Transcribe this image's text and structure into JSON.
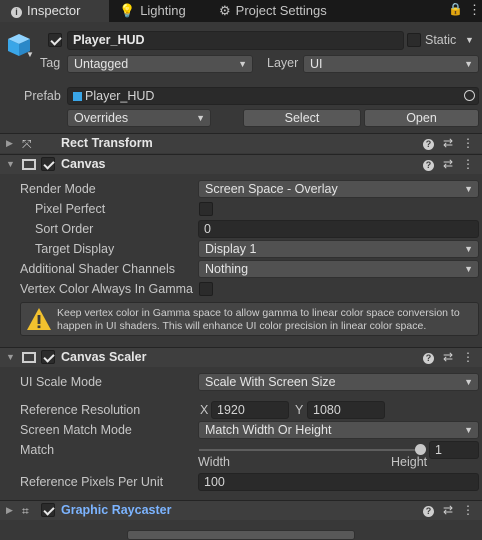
{
  "tabs": [
    {
      "label": "Inspector",
      "icon": "info-icon"
    },
    {
      "label": "Lighting",
      "icon": "bulb-icon"
    },
    {
      "label": "Project Settings",
      "icon": "gear-icon"
    }
  ],
  "object": {
    "name": "Player_HUD",
    "static_label": "Static",
    "tag_label": "Tag",
    "tag_value": "Untagged",
    "layer_label": "Layer",
    "layer_value": "UI",
    "prefab_label": "Prefab",
    "prefab_value": "Player_HUD",
    "overrides_label": "Overrides",
    "select_label": "Select",
    "open_label": "Open"
  },
  "components": {
    "rect_transform": {
      "title": "Rect Transform"
    },
    "canvas": {
      "title": "Canvas",
      "render_mode_label": "Render Mode",
      "render_mode_value": "Screen Space - Overlay",
      "pixel_perfect_label": "Pixel Perfect",
      "sort_order_label": "Sort Order",
      "sort_order_value": "0",
      "target_display_label": "Target Display",
      "target_display_value": "Display 1",
      "shader_channels_label": "Additional Shader Channels",
      "shader_channels_value": "Nothing",
      "vertex_color_label": "Vertex Color Always In Gamma",
      "warning_text": "Keep vertex color in Gamma space to allow gamma to linear color space conversion to happen in UI shaders. This will enhance UI color precision in linear color space."
    },
    "canvas_scaler": {
      "title": "Canvas Scaler",
      "scale_mode_label": "UI Scale Mode",
      "scale_mode_value": "Scale With Screen Size",
      "ref_res_label": "Reference Resolution",
      "x_label": "X",
      "x_value": "1920",
      "y_label": "Y",
      "y_value": "1080",
      "match_mode_label": "Screen Match Mode",
      "match_mode_value": "Match Width Or Height",
      "match_label": "Match",
      "match_value": "1",
      "width_label": "Width",
      "height_label": "Height",
      "ppu_label": "Reference Pixels Per Unit",
      "ppu_value": "100"
    },
    "graphic_raycaster": {
      "title": "Graphic Raycaster"
    }
  },
  "colors": {
    "accent_title": "#7cb4ff",
    "warning": "#f2c12e"
  }
}
